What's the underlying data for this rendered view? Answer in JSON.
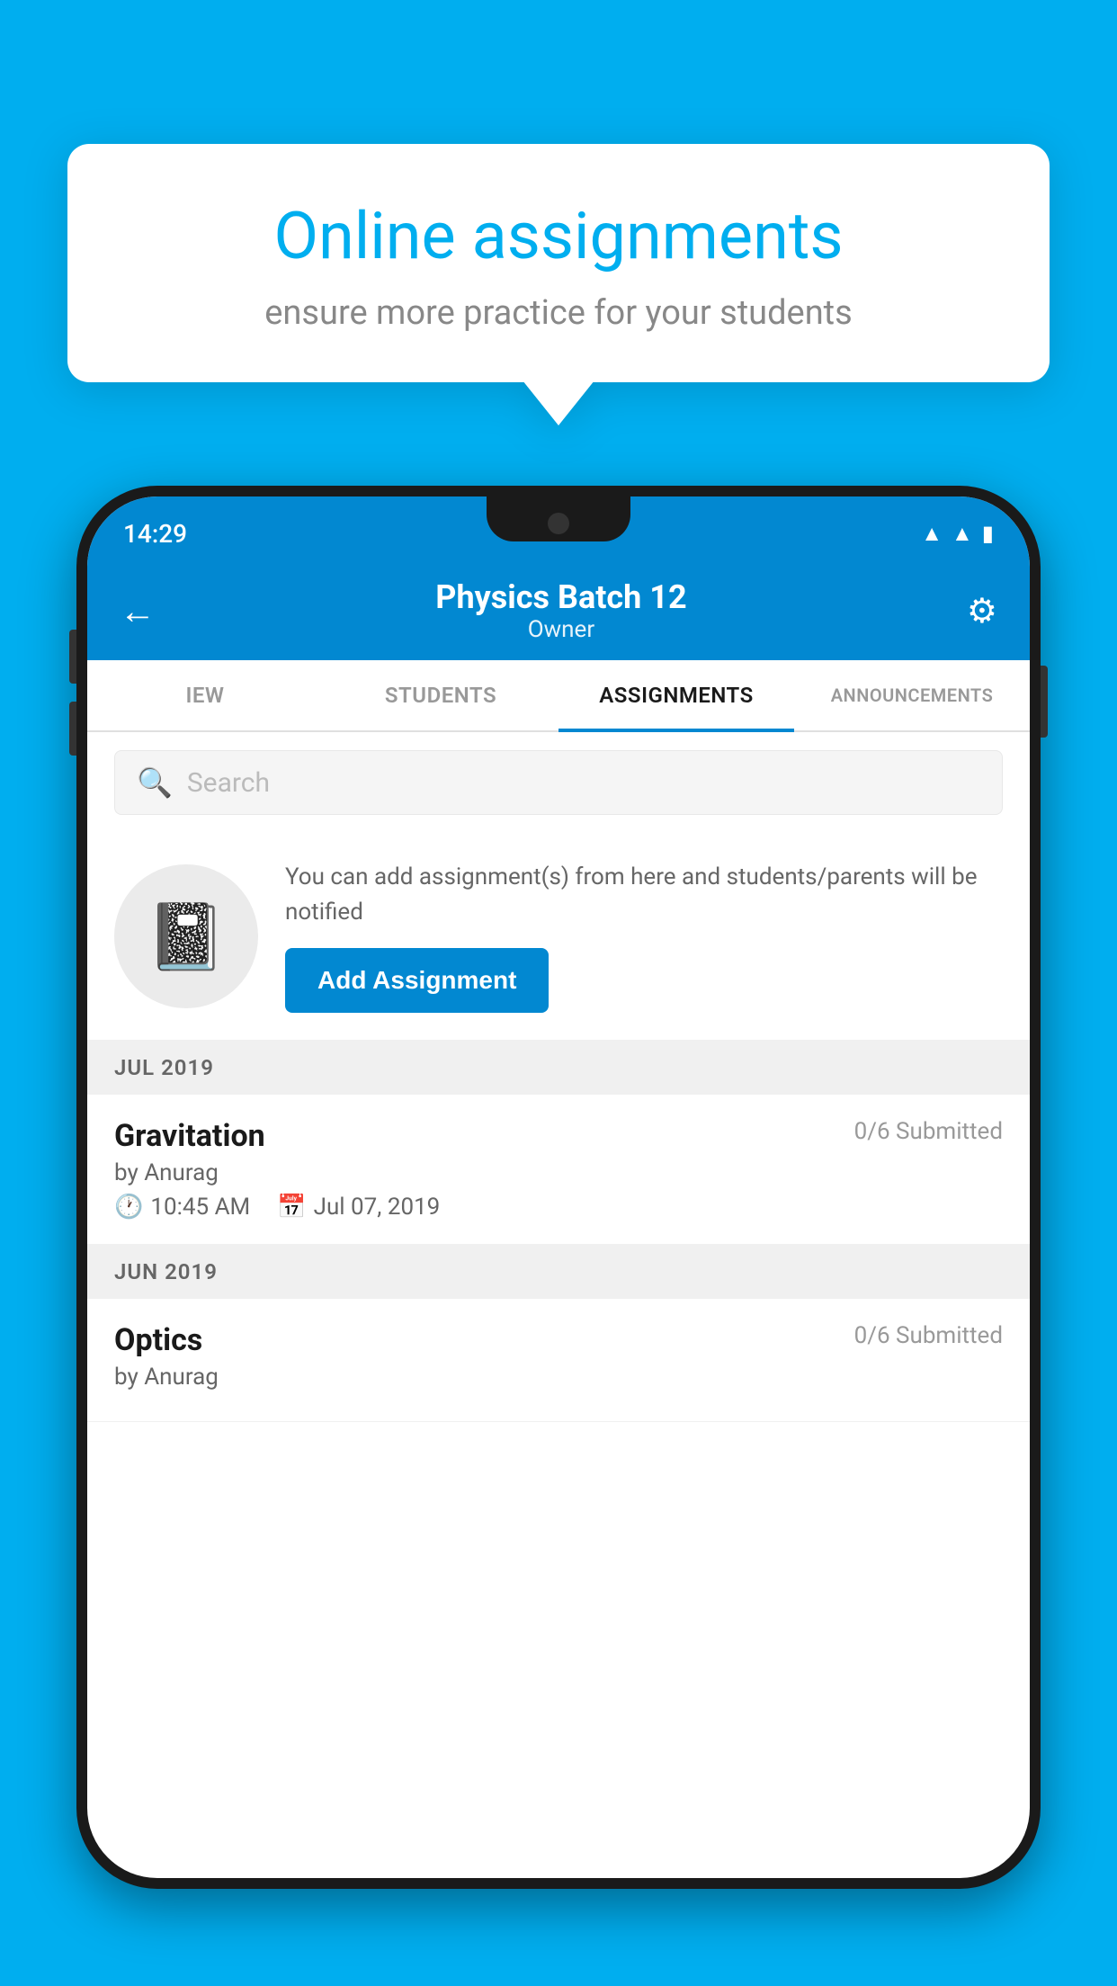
{
  "background_color": "#00AEEF",
  "promo": {
    "title": "Online assignments",
    "subtitle": "ensure more practice for your students"
  },
  "status_bar": {
    "time": "14:29",
    "wifi_icon": "▲",
    "signal_icon": "▲",
    "battery_icon": "▮"
  },
  "header": {
    "title": "Physics Batch 12",
    "subtitle": "Owner",
    "back_icon": "←",
    "settings_icon": "⚙"
  },
  "tabs": [
    {
      "label": "IEW",
      "active": false
    },
    {
      "label": "STUDENTS",
      "active": false
    },
    {
      "label": "ASSIGNMENTS",
      "active": true
    },
    {
      "label": "ANNOUNCEMENTS",
      "active": false
    }
  ],
  "search": {
    "placeholder": "Search"
  },
  "add_assignment": {
    "description": "You can add assignment(s) from here and students/parents will be notified",
    "button_label": "Add Assignment",
    "icon": "📓"
  },
  "sections": [
    {
      "month_label": "JUL 2019",
      "assignments": [
        {
          "name": "Gravitation",
          "submitted": "0/6 Submitted",
          "by": "by Anurag",
          "time": "10:45 AM",
          "date": "Jul 07, 2019"
        }
      ]
    },
    {
      "month_label": "JUN 2019",
      "assignments": [
        {
          "name": "Optics",
          "submitted": "0/6 Submitted",
          "by": "by Anurag",
          "time": "",
          "date": ""
        }
      ]
    }
  ]
}
